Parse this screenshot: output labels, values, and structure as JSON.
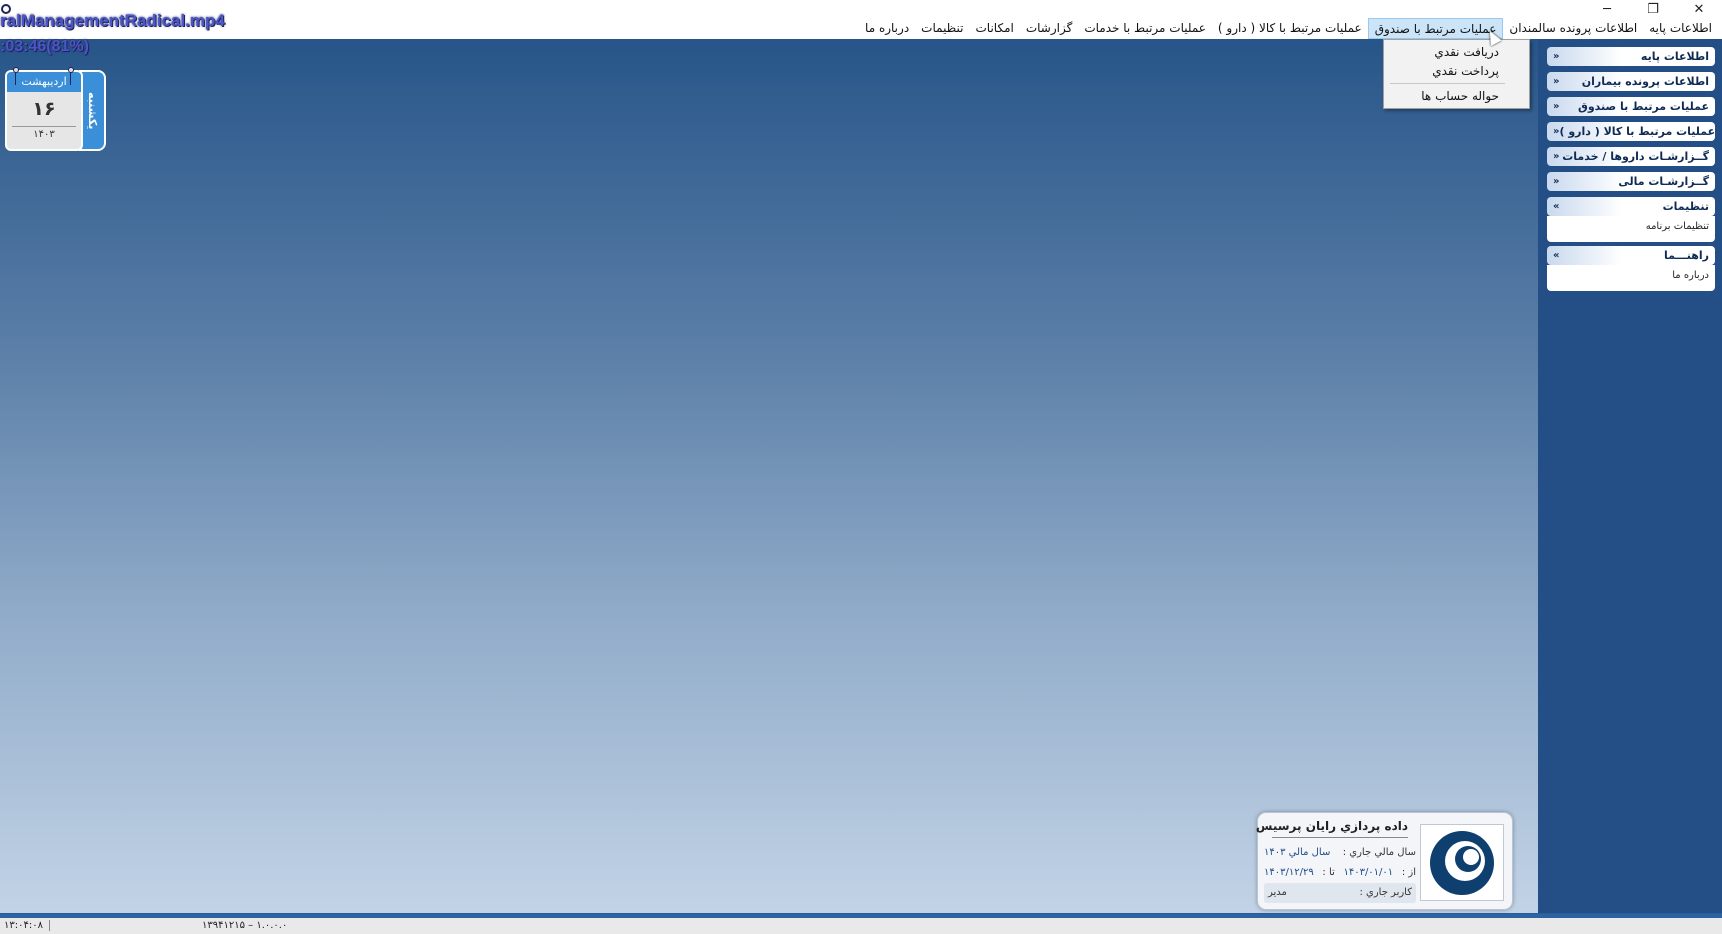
{
  "video": {
    "title": "ralManagementRadical.mp4",
    "timer": ":03:46(81%)"
  },
  "window_controls": {
    "minimize": "─",
    "restore": "❐",
    "close": "✕"
  },
  "menubar": {
    "items": [
      {
        "label": "اطلاعات پايه",
        "active": false
      },
      {
        "label": "اطلاعات پرونده سالمندان",
        "active": false
      },
      {
        "label": "عمليات مرتبط با صندوق",
        "active": true
      },
      {
        "label": "عمليات مرتبط با كالا ( دارو )",
        "active": false
      },
      {
        "label": "عمليات مرتبط با خدمات",
        "active": false
      },
      {
        "label": "گزارشات",
        "active": false
      },
      {
        "label": "امكانات",
        "active": false
      },
      {
        "label": "تنظيمات",
        "active": false
      },
      {
        "label": "درباره ما",
        "active": false
      }
    ]
  },
  "dropdown": {
    "items": [
      "دريافت نقدي",
      "پرداخت نقدي",
      "حواله حساب ها"
    ]
  },
  "calendar": {
    "month": "ارديبهشت",
    "day": "۱۶",
    "year": "۱۴۰۳",
    "weekday": "يكشنبه"
  },
  "sidepanel": {
    "groups": [
      {
        "title": "اطلاعات پايه",
        "expanded": false,
        "items": []
      },
      {
        "title": "اطلاعات پرونده بيماران",
        "expanded": false,
        "items": []
      },
      {
        "title": "عمليات مرتبط با صندوق",
        "expanded": false,
        "items": []
      },
      {
        "title": "عمليات مرتبط با كالا ( دارو )",
        "expanded": false,
        "items": []
      },
      {
        "title": "گــزارشـات داروها / خدمات",
        "expanded": false,
        "items": []
      },
      {
        "title": "گــزارشـات مالی",
        "expanded": false,
        "items": []
      },
      {
        "title": "تنظيمات",
        "expanded": true,
        "items": [
          "تنظيمات برنامه"
        ]
      },
      {
        "title": "راهنـــما",
        "expanded": true,
        "items": [
          "درباره ما"
        ]
      }
    ]
  },
  "card": {
    "company": "داده پردازي رايان پرسيس",
    "fiscal_label": "سال مالي جاري  :",
    "fiscal_value": "سال مالي ۱۴۰۳",
    "from_label": "از :",
    "from_value": "۱۴۰۳/۰۱/۰۱",
    "to_label": "تا :",
    "to_value": "۱۴۰۳/۱۲/۲۹",
    "user_label": "كاربر جاري :",
    "user_value": "مدير"
  },
  "statusbar": {
    "time": "۱۳:۰۴:۰۸",
    "version": "۱۳۹۴۱۲۱۵ – ۱.۰.۰.۰"
  },
  "colors": {
    "sidepanel": "#234f86",
    "accent": "#3b8fd8",
    "menu_active": "#cce4f7"
  }
}
